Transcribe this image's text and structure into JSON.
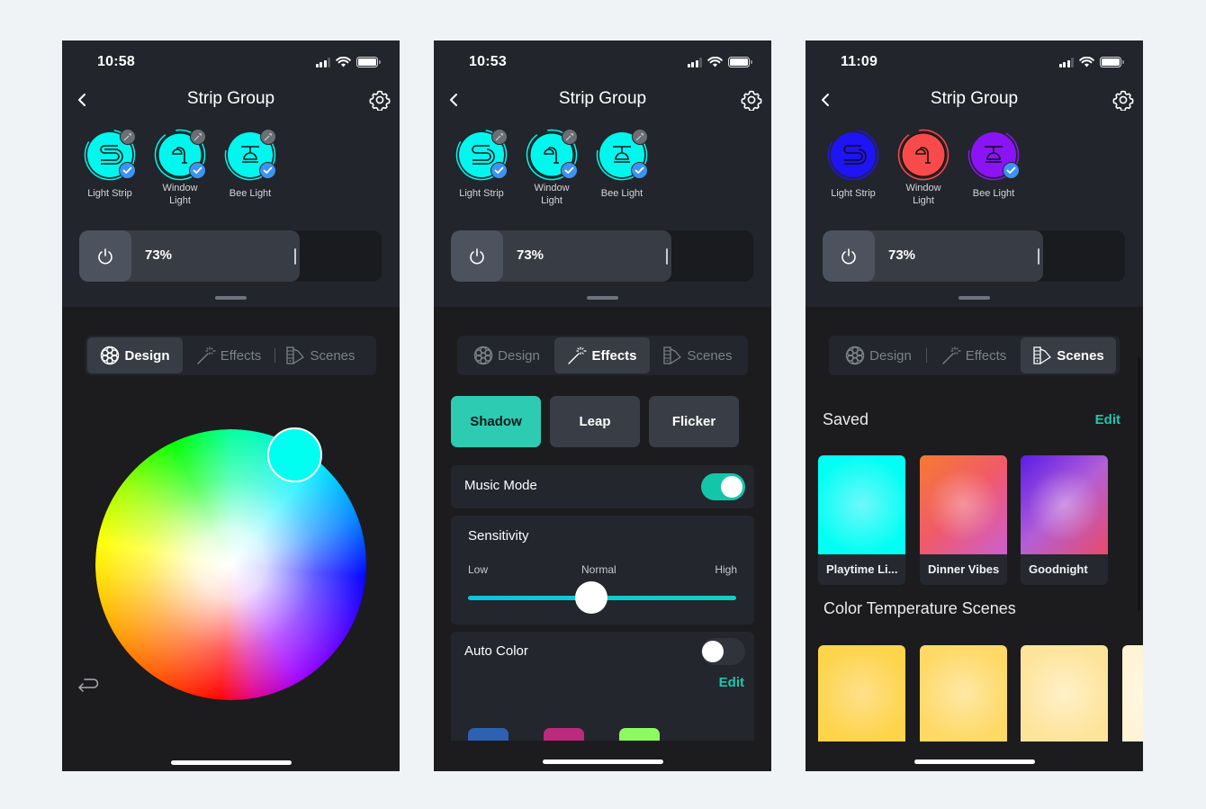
{
  "screens": [
    {
      "status_time": "10:58",
      "title": "Strip Group",
      "devices": [
        {
          "name": "Light Strip",
          "icon": "strip-icon",
          "color": "#00f7ee",
          "fx_badge": true,
          "checked": true
        },
        {
          "name": "Window Light",
          "icon": "desk-lamp-icon",
          "color": "#00f7ee",
          "fx_badge": true,
          "checked": true
        },
        {
          "name": "Bee Light",
          "icon": "pendant-lamp-icon",
          "color": "#00f7ee",
          "fx_badge": true,
          "checked": true
        }
      ],
      "brightness": {
        "label": "73%",
        "value_percent": 73
      },
      "tabs": [
        {
          "label": "Design",
          "icon": "color-wheel-icon",
          "active": true
        },
        {
          "label": "Effects",
          "icon": "magic-wand-icon",
          "active": false
        },
        {
          "label": "Scenes",
          "icon": "swatches-icon",
          "active": false
        }
      ],
      "design": {
        "selected_color": "#00fff0",
        "reset_icon": "undo-arrow-icon"
      }
    },
    {
      "status_time": "10:53",
      "title": "Strip Group",
      "devices": [
        {
          "name": "Light Strip",
          "icon": "strip-icon",
          "color": "#00f7ee",
          "fx_badge": true,
          "checked": true
        },
        {
          "name": "Window Light",
          "icon": "desk-lamp-icon",
          "color": "#00f7ee",
          "fx_badge": true,
          "checked": true
        },
        {
          "name": "Bee Light",
          "icon": "pendant-lamp-icon",
          "color": "#00f7ee",
          "fx_badge": true,
          "checked": true
        }
      ],
      "brightness": {
        "label": "73%",
        "value_percent": 73
      },
      "tabs": [
        {
          "label": "Design",
          "icon": "color-wheel-icon",
          "active": false
        },
        {
          "label": "Effects",
          "icon": "magic-wand-icon",
          "active": true
        },
        {
          "label": "Scenes",
          "icon": "swatches-icon",
          "active": false
        }
      ],
      "effects": {
        "presets": [
          {
            "label": "Shadow",
            "active": true
          },
          {
            "label": "Leap",
            "active": false
          },
          {
            "label": "Flicker",
            "active": false
          }
        ],
        "music_mode": {
          "label": "Music Mode",
          "on": true
        },
        "sensitivity": {
          "label": "Sensitivity",
          "low_label": "Low",
          "mid_label": "Normal",
          "high_label": "High",
          "value_fraction": 0.46
        },
        "auto_color": {
          "label": "Auto Color",
          "on": false,
          "edit_label": "Edit",
          "swatches": [
            "#2d62b0",
            "#bb2a7c",
            "#8efa62"
          ]
        }
      }
    },
    {
      "status_time": "11:09",
      "title": "Strip Group",
      "devices": [
        {
          "name": "Light Strip",
          "icon": "strip-icon",
          "color": "#1e14f5",
          "fx_badge": false,
          "checked": false
        },
        {
          "name": "Window Light",
          "icon": "desk-lamp-icon",
          "color": "#f84a4b",
          "fx_badge": false,
          "checked": false
        },
        {
          "name": "Bee Light",
          "icon": "pendant-lamp-icon",
          "color": "#8a14f5",
          "fx_badge": false,
          "checked": true
        }
      ],
      "brightness": {
        "label": "73%",
        "value_percent": 73
      },
      "tabs": [
        {
          "label": "Design",
          "icon": "color-wheel-icon",
          "active": false
        },
        {
          "label": "Effects",
          "icon": "magic-wand-icon",
          "active": false
        },
        {
          "label": "Scenes",
          "icon": "swatches-icon",
          "active": true
        }
      ],
      "scenes": {
        "saved_title": "Saved",
        "edit_label": "Edit",
        "saved": [
          {
            "name": "Playtime Li...",
            "colors": [
              "#00fff4",
              "#6ff8fb"
            ]
          },
          {
            "name": "Dinner Vibes",
            "colors": [
              "#f77a32",
              "#f05a6a",
              "#cc5fd0"
            ]
          },
          {
            "name": "Goodnight",
            "colors": [
              "#5b1ce6",
              "#b45fd6",
              "#e84b6a"
            ]
          }
        ],
        "temperature_title": "Color Temperature Scenes",
        "temperature": [
          {
            "colors": [
              "#fdd44a",
              "#fee08a"
            ]
          },
          {
            "colors": [
              "#fed965",
              "#fee8a5"
            ]
          },
          {
            "colors": [
              "#fee49a",
              "#fff0c8"
            ]
          },
          {
            "colors": [
              "#fff4d6",
              "#fffae9"
            ]
          }
        ]
      }
    }
  ]
}
